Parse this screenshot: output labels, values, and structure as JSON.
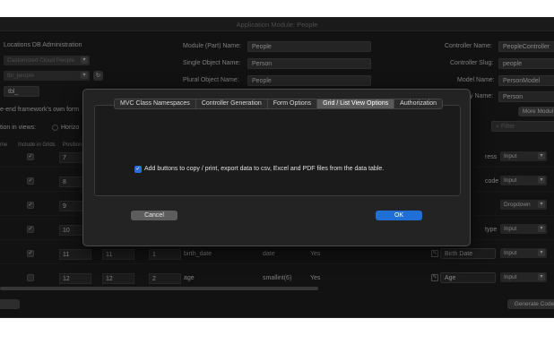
{
  "window": {
    "title": "Application Module: People"
  },
  "left": {
    "heading": "Locations DB Administration",
    "select1": "Customized Cloud People",
    "select2": "tbl_people",
    "field3": "tbl_",
    "framework_text": "e-end framework's own form",
    "position_label": "tion in views:",
    "horizontal_label": "Horizo"
  },
  "center": {
    "module_name_label": "Module (Part) Name:",
    "module_name_value": "People",
    "single_label": "Single Object Name:",
    "single_value": "Person",
    "plural_label": "Plural Object Name:",
    "plural_value": "People"
  },
  "right": {
    "controller_name_label": "Controller Name:",
    "controller_name_value": "PeopleController",
    "controller_slug_label": "Controller Slug:",
    "controller_slug_value": "people",
    "model_name_label": "Model Name:",
    "model_name_value": "PersonModel",
    "entity_label": "y Name:",
    "entity_value": "Person",
    "more_button": "More Modul",
    "filter_placeholder": "Filter"
  },
  "grid": {
    "headers": {
      "name": "me",
      "include": "Include in Grids",
      "position": "Position"
    },
    "rows": [
      {
        "pos": "7",
        "label_end": "ress",
        "input": "Input"
      },
      {
        "pos": "8",
        "label_end": "code",
        "input": "Input"
      },
      {
        "pos": "9",
        "label_end": "",
        "input": "Dropdown"
      },
      {
        "pos": "10",
        "label_end": "type",
        "input": "Input"
      },
      {
        "pos": "11",
        "pos2": "11",
        "order": "1",
        "field": "birth_date",
        "type": "date",
        "nullable": "Yes",
        "label": "Birth Date",
        "input": "Input"
      },
      {
        "pos": "12",
        "pos2": "12",
        "order": "2",
        "field": "age",
        "type": "smallint(6)",
        "nullable": "Yes",
        "label": "Age",
        "input": "Input"
      }
    ]
  },
  "footer": {
    "generate_button": "Generate Code"
  },
  "dialog": {
    "tabs": [
      "MVC Class Namespaces",
      "Controller Generation",
      "Form Options",
      "Grid / List View Options",
      "Authorization"
    ],
    "active_tab": "Grid / List View Options",
    "checkbox_label": "Add buttons to copy / print, export data to csv, Excel and PDF files from the data table.",
    "cancel": "Cancel",
    "ok": "OK",
    "colors": {
      "accent": "#1f6fd6",
      "background": "#232323"
    }
  }
}
